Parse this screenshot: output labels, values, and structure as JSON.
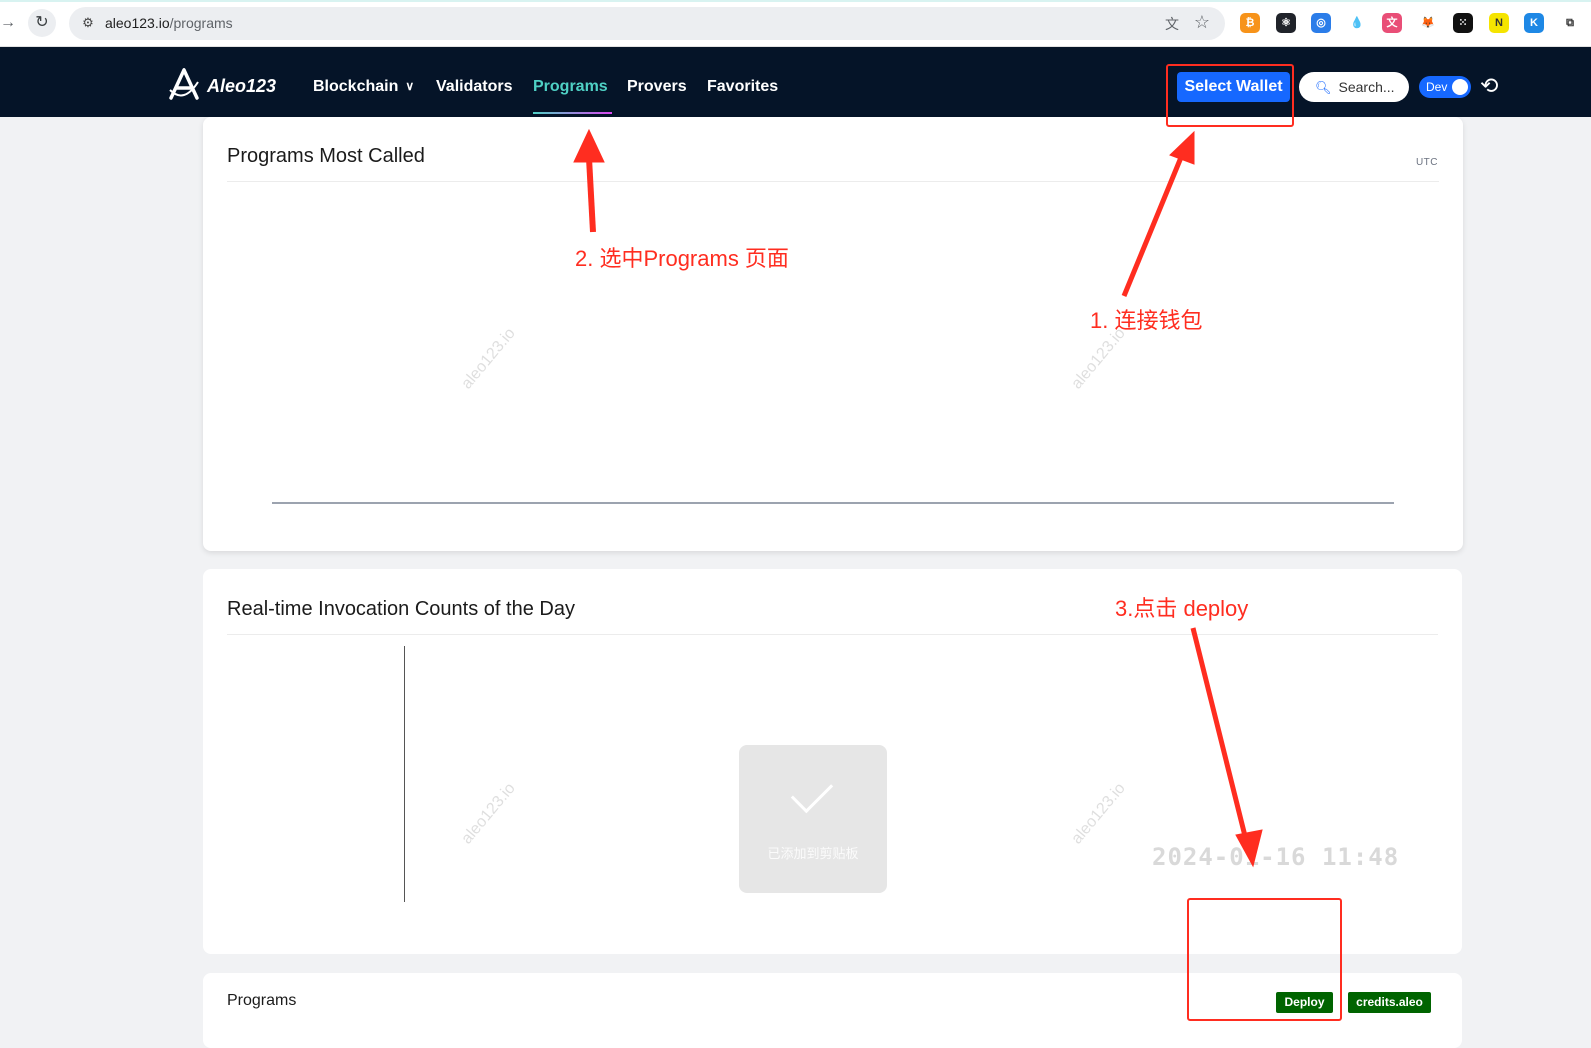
{
  "browser": {
    "url_host": "aleo123.io",
    "url_path": "/programs",
    "extensions": [
      {
        "name": "coin-extension-icon",
        "color": "#f7931a",
        "glyph": "₿"
      },
      {
        "name": "react-devtools-icon",
        "color": "#20232a",
        "glyph": "⚛"
      },
      {
        "name": "globe-extension-icon",
        "color": "#2b7de9",
        "glyph": "◎"
      },
      {
        "name": "drop-extension-icon",
        "color": "#ffffff",
        "glyph": "💧"
      },
      {
        "name": "translate-extension-icon",
        "color": "#e94e77",
        "glyph": "文"
      },
      {
        "name": "metamask-icon",
        "color": "#ffffff",
        "glyph": "🦊"
      },
      {
        "name": "dice-extension-icon",
        "color": "#111111",
        "glyph": "⁙"
      },
      {
        "name": "n-extension-icon",
        "color": "#f5e400",
        "glyph": "N"
      },
      {
        "name": "k-extension-icon",
        "color": "#1e88e5",
        "glyph": "K"
      },
      {
        "name": "puzzle-extension-icon",
        "color": "#ffffff",
        "glyph": "⧉"
      }
    ]
  },
  "nav": {
    "logo_text": "Aleo123",
    "links": {
      "blockchain": "Blockchain",
      "validators": "Validators",
      "programs": "Programs",
      "provers": "Provers",
      "favorites": "Favorites"
    },
    "select_wallet": "Select Wallet",
    "search_placeholder": "Search...",
    "dev_toggle_label": "Dev"
  },
  "cards": {
    "most_called": {
      "title": "Programs Most Called",
      "timezone": "UTC"
    },
    "realtime": {
      "title": "Real-time Invocation Counts of the Day",
      "toast_message": "已添加到剪贴板",
      "timestamp": "2024-01-16 11:48"
    },
    "programs": {
      "title": "Programs",
      "deploy_label": "Deploy",
      "credits_label": "credits.aleo"
    }
  },
  "watermark": "aleo123.io",
  "annotations": {
    "step1": "1. 连接钱包",
    "step2": "2. 选中Programs 页面",
    "step3": "3.点击 deploy",
    "color": "#ff2d20"
  },
  "colors": {
    "nav_bg": "#051428",
    "active_link": "#4fd1c5",
    "wallet_button": "#1668ff",
    "badge_green": "#006400"
  }
}
